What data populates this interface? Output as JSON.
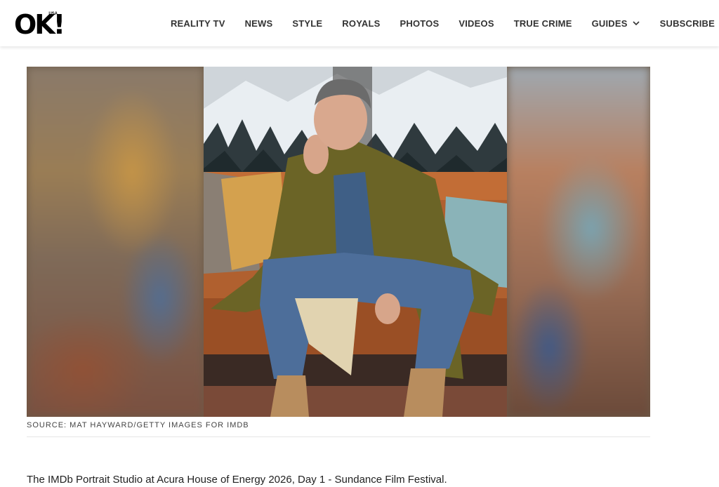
{
  "brand": {
    "logo": "OK!",
    "logo_superscript": "USA"
  },
  "nav": {
    "items": [
      {
        "label": "REALITY TV"
      },
      {
        "label": "NEWS"
      },
      {
        "label": "STYLE"
      },
      {
        "label": "ROYALS"
      },
      {
        "label": "PHOTOS"
      },
      {
        "label": "VIDEOS"
      },
      {
        "label": "TRUE CRIME"
      },
      {
        "label": "GUIDES",
        "icon": "chevron-down-icon"
      },
      {
        "label": "SUBSCRIBE"
      }
    ]
  },
  "article": {
    "image_credit": "SOURCE: MAT HAYWARD/GETTY IMAGES FOR IMDB",
    "caption": "The IMDb Portrait Studio at Acura House of Energy 2026, Day 1 - Sundance Film Festival."
  },
  "colors": {
    "nav_text": "#333333",
    "rule": "#e6e6e6"
  }
}
